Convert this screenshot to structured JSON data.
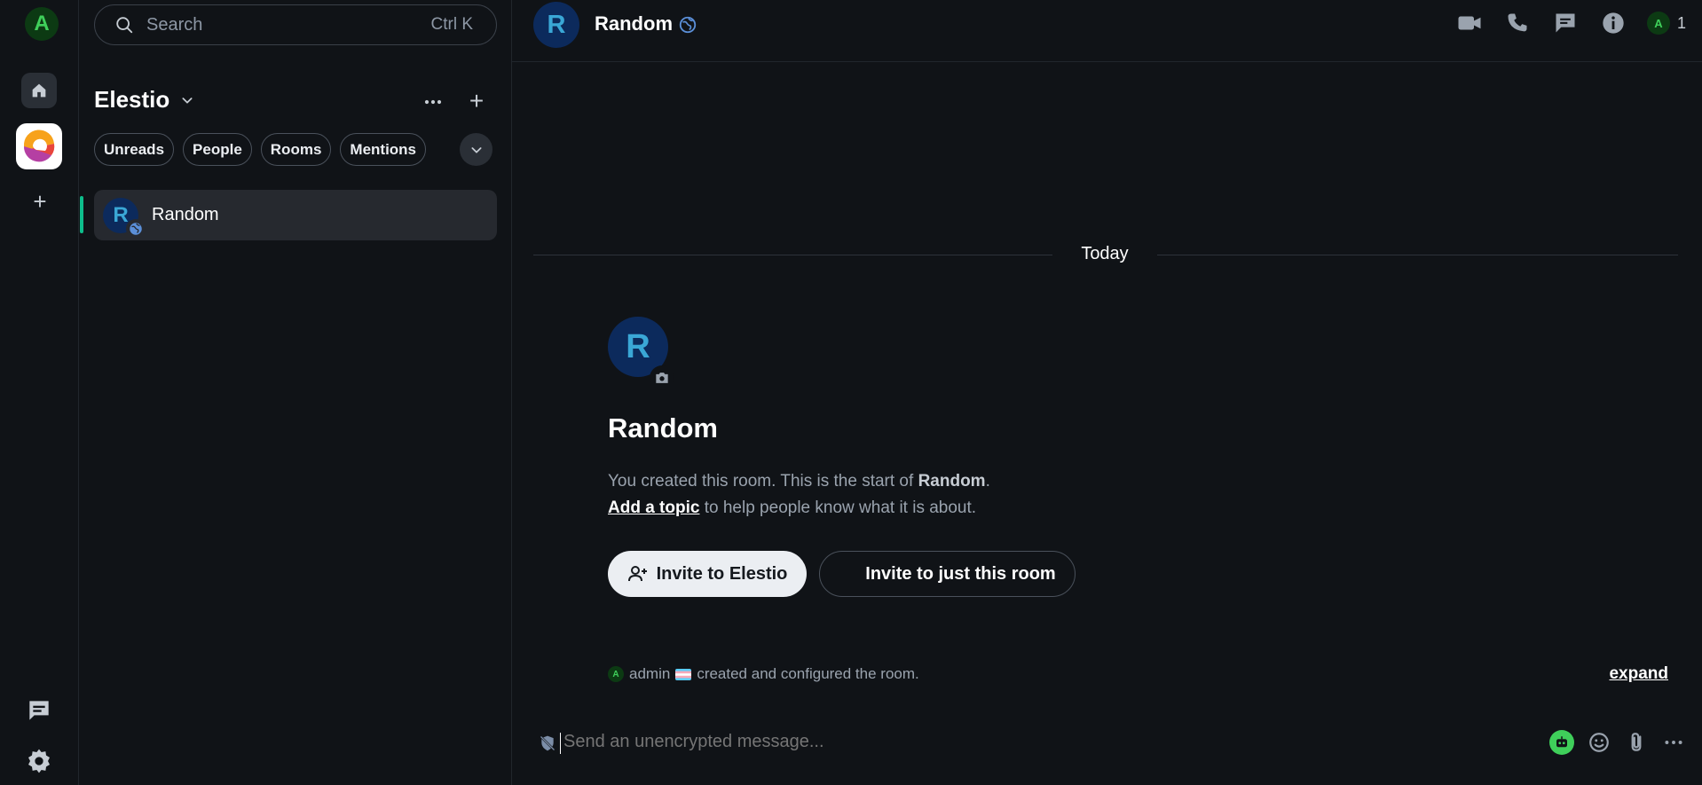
{
  "colors": {
    "background": "#101317",
    "accent_green": "#0dbd8b",
    "avatar_blue_bg": "#0c2a5c",
    "avatar_blue_fg": "#3aa7d6",
    "user_green_fg": "#3fcf5a"
  },
  "spacebar": {
    "user_initial": "A",
    "home_icon": "home-icon",
    "active_space_icon": "elestio-logo",
    "add_space_label": "+",
    "threads_icon": "threads-icon",
    "settings_icon": "gear-icon"
  },
  "roomlist": {
    "search": {
      "placeholder": "Search",
      "shortcut": "Ctrl K"
    },
    "space_name": "Elestio",
    "add_label": "+",
    "filters": [
      "Unreads",
      "People",
      "Rooms",
      "Mentions"
    ],
    "rooms": [
      {
        "initial": "R",
        "name": "Random",
        "selected": true
      }
    ]
  },
  "header": {
    "room_initial": "R",
    "room_name": "Random",
    "icons": [
      "video-call-icon",
      "voice-call-icon",
      "threads-icon",
      "room-info-icon"
    ],
    "member_initial": "A",
    "member_count": "1"
  },
  "timeline": {
    "date_separator": "Today",
    "intro": {
      "avatar_initial": "R",
      "title": "Random",
      "line1_prefix": "You created this room. This is the start of ",
      "line1_room": "Random",
      "line1_suffix": ".",
      "topic_link": "Add a topic",
      "line2_suffix": " to help people know what it is about."
    },
    "buttons": {
      "invite_space": "Invite to Elestio",
      "invite_room": "Invite to just this room"
    },
    "event_summary": {
      "avatar_initial": "A",
      "user": "admin",
      "text": "created and configured the room.",
      "expand_label": "expand"
    }
  },
  "composer": {
    "placeholder": "Send an unencrypted message...",
    "icons": [
      "bot-icon",
      "emoji-icon",
      "attachment-icon",
      "more-options-icon"
    ]
  }
}
